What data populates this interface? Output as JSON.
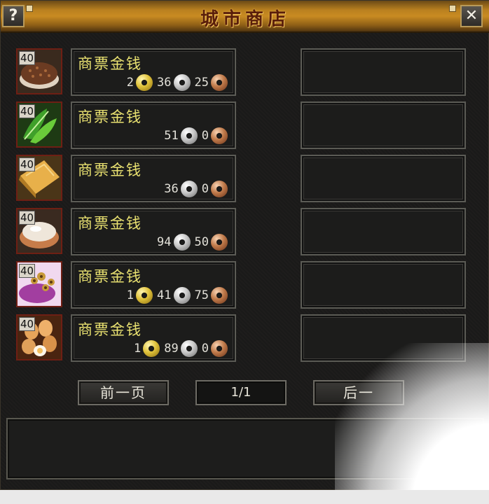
{
  "window": {
    "title": "城市商店",
    "help_label": "?",
    "close_label": "✕"
  },
  "items": [
    {
      "icon": "spice-bowl-icon",
      "count": "40",
      "currency": "商票金钱",
      "gold": "2",
      "silver": "36",
      "copper": "25"
    },
    {
      "icon": "green-vegetable-icon",
      "count": "40",
      "currency": "商票金钱",
      "gold": null,
      "silver": "51",
      "copper": "0"
    },
    {
      "icon": "flatbread-icon",
      "count": "40",
      "currency": "商票金钱",
      "gold": null,
      "silver": "36",
      "copper": "0"
    },
    {
      "icon": "rice-bowl-icon",
      "count": "40",
      "currency": "商票金钱",
      "gold": null,
      "silver": "94",
      "copper": "50"
    },
    {
      "icon": "taro-beans-icon",
      "count": "40",
      "currency": "商票金钱",
      "gold": "1",
      "silver": "41",
      "copper": "75"
    },
    {
      "icon": "eggs-icon",
      "count": "40",
      "currency": "商票金钱",
      "gold": "1",
      "silver": "89",
      "copper": "0"
    }
  ],
  "pagination": {
    "prev_label": "前一页",
    "page": "1/1",
    "next_label": "后一"
  },
  "colors": {
    "title_bar": "#c98b22",
    "currency_text": "#e8e070",
    "slot_border": "#6e1f14"
  }
}
